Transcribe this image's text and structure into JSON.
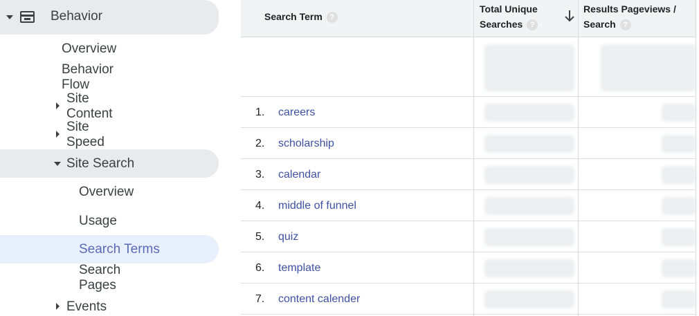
{
  "sidebar": {
    "section_label": "Behavior",
    "items": [
      {
        "label": "Overview"
      },
      {
        "label": "Behavior Flow"
      },
      {
        "label": "Site Content"
      },
      {
        "label": "Site Speed"
      },
      {
        "label": "Site Search"
      },
      {
        "label": "Overview"
      },
      {
        "label": "Usage"
      },
      {
        "label": "Search Terms"
      },
      {
        "label": "Search Pages"
      },
      {
        "label": "Events"
      }
    ]
  },
  "table": {
    "columns": [
      {
        "label": "Search Term"
      },
      {
        "label_line1": "Total Unique",
        "label_line2": "Searches"
      },
      {
        "label_line1": "Results Pageviews /",
        "label_line2": "Search"
      }
    ],
    "help_glyph": "?",
    "rows": [
      {
        "index": "1.",
        "term": "careers"
      },
      {
        "index": "2.",
        "term": "scholarship"
      },
      {
        "index": "3.",
        "term": "calendar"
      },
      {
        "index": "4.",
        "term": "middle of funnel"
      },
      {
        "index": "5.",
        "term": "quiz"
      },
      {
        "index": "6.",
        "term": "template"
      },
      {
        "index": "7.",
        "term": "content calender"
      }
    ]
  },
  "colors": {
    "active_item_bg": "#e8f0fe",
    "active_item_text": "#5b6ab5",
    "link": "#3f51a3",
    "header_bg": "#f1f3f4"
  }
}
